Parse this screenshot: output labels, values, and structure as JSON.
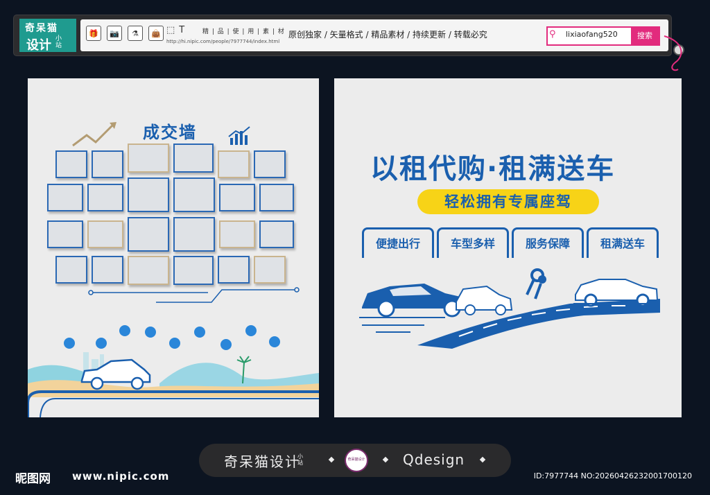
{
  "logo": {
    "line1": "奇呆猫",
    "line2": "设计",
    "line3": "小站"
  },
  "toolbar": {
    "categories": "精 | 品 | 使 | 用 | 素 | 材",
    "url": "http://hi.nipic.com/people/7977744/index.html",
    "slogan": "原创独家 / 矢量格式 / 精品素材 / 持续更新 / 转载必究",
    "search_value": "lixiaofang520",
    "search_button": "搜索"
  },
  "left_panel": {
    "title": "成交墙"
  },
  "right_panel": {
    "title": "以租代购·租满送车",
    "subtitle": "轻松拥有专属座驾",
    "features": [
      "便捷出行",
      "车型多样",
      "服务保障",
      "租满送车"
    ]
  },
  "bottom_bar": {
    "brand": "奇呆猫设计",
    "brand_small": "小站",
    "seal": "奇呆猫设计",
    "qdesign": "Qdesign"
  },
  "footer": {
    "site_cn": "昵图网",
    "site_url": "www.nipic.com",
    "id_text": "ID:7977744 NO:20260426232001700120"
  },
  "colors": {
    "blue": "#1a5fae",
    "yellow": "#f7d317",
    "teal": "#1f9b8f",
    "pink": "#e22b7d"
  }
}
